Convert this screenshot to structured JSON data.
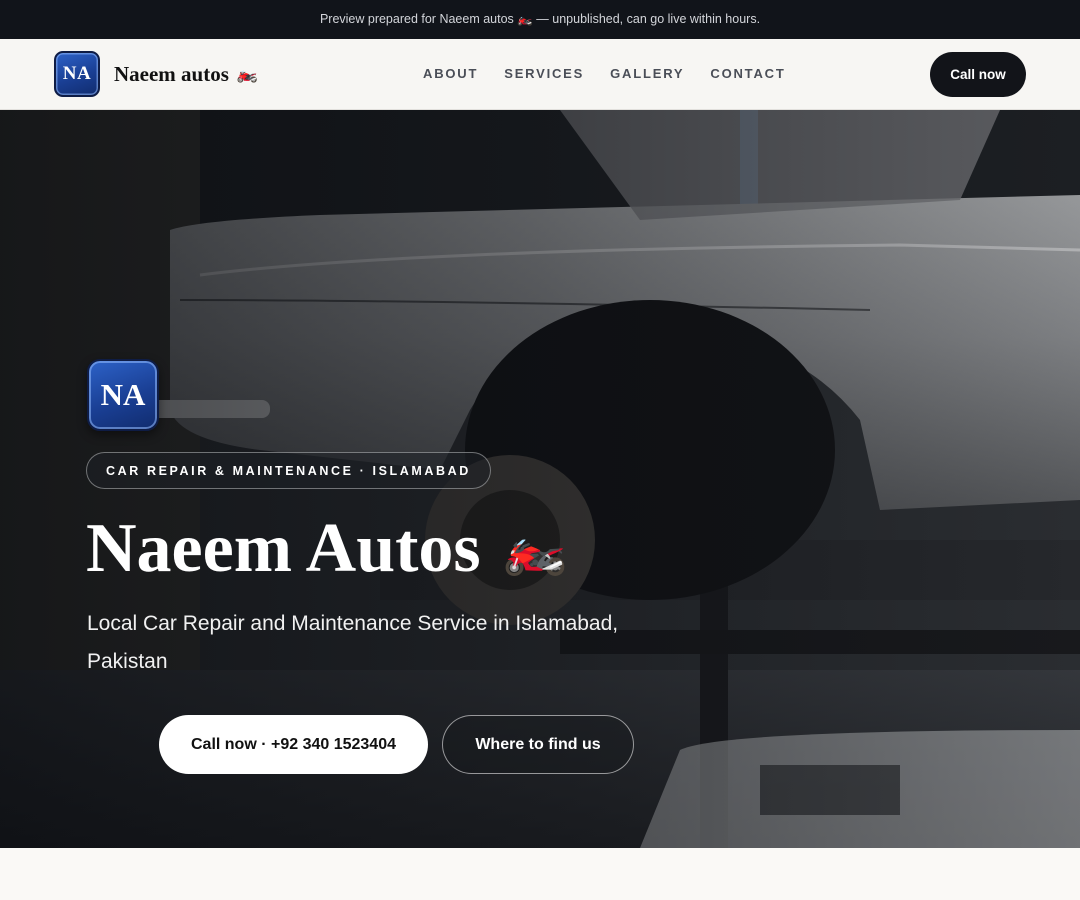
{
  "preview_bar": {
    "text": "Preview prepared for Naeem autos 🏍️ — unpublished, can go live within hours."
  },
  "header": {
    "logo_initials": "NA",
    "brand_name": "Naeem autos",
    "brand_emoji": "🏍️",
    "nav": [
      {
        "label": "ABOUT"
      },
      {
        "label": "SERVICES"
      },
      {
        "label": "GALLERY"
      },
      {
        "label": "CONTACT"
      }
    ],
    "cta_label": "Call now"
  },
  "hero": {
    "logo_initials": "NA",
    "tag": "CAR REPAIR & MAINTENANCE · ISLAMABAD",
    "title": "Naeem Autos",
    "title_emoji": "🏍️",
    "subtitle": "Local Car Repair and Maintenance Service in Islamabad, Pakistan",
    "primary_button": "Call now · +92 340 1523404",
    "secondary_button": "Where to find us",
    "background_image": "vintage silver sedan lifted on a repair hoist in a workshop"
  },
  "colors": {
    "topbar_bg": "#11141a",
    "nav_bg": "#f7f6f3",
    "cta_bg": "#121419",
    "logo_blue": "#1a3f94",
    "page_bg": "#faf9f6"
  }
}
